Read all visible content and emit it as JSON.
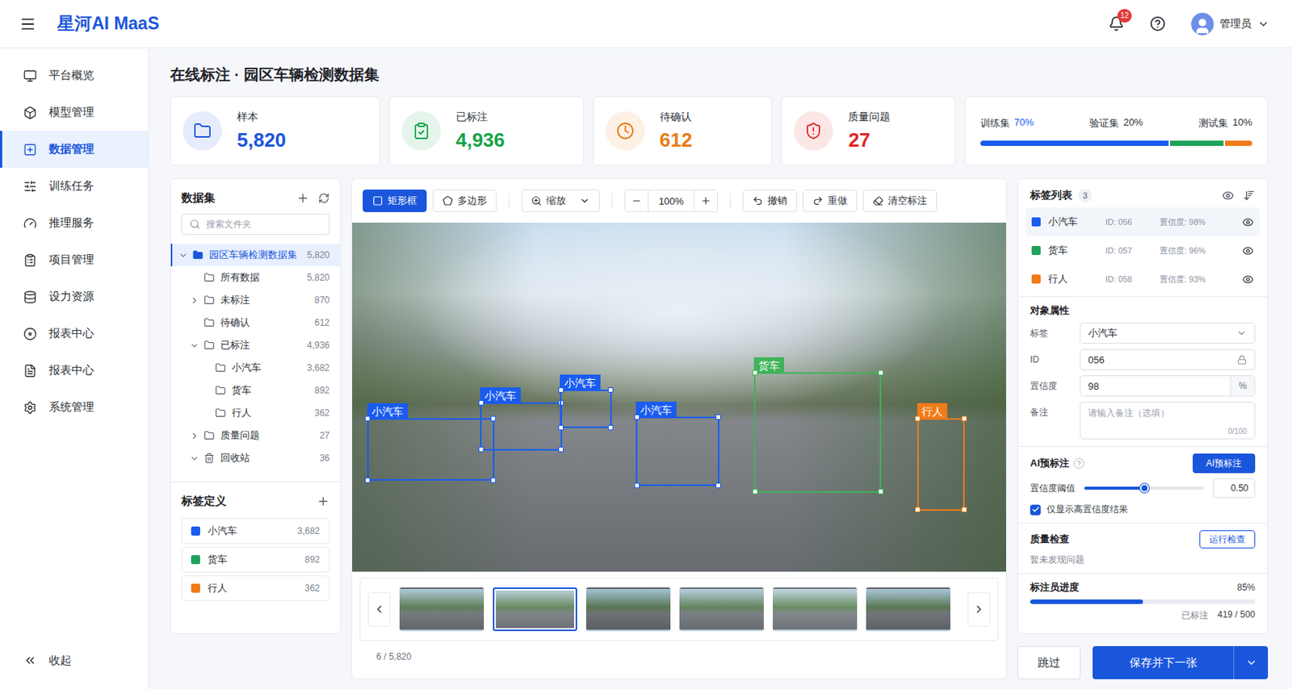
{
  "topbar": {
    "logo": "星河AI MaaS",
    "notifications": "12",
    "user": "管理员"
  },
  "sidebar": {
    "items": [
      {
        "label": "平台概览",
        "selected": false
      },
      {
        "label": "模型管理",
        "selected": false
      },
      {
        "label": "数据管理",
        "selected": true
      },
      {
        "label": "训练任务",
        "selected": false
      },
      {
        "label": "推理服务",
        "selected": false
      },
      {
        "label": "项目管理",
        "selected": false
      },
      {
        "label": "设力资源",
        "selected": false
      },
      {
        "label": "报表中心",
        "selected": false
      },
      {
        "label": "报表中心",
        "selected": false
      },
      {
        "label": "系统管理",
        "selected": false
      }
    ],
    "collapse": "收起"
  },
  "page": {
    "title": "在线标注 · 园区车辆检测数据集"
  },
  "stats": [
    {
      "label": "样本",
      "value": "5,820",
      "kind": "samples",
      "color": "#1a56db"
    },
    {
      "label": "已标注",
      "value": "4,936",
      "kind": "labeled",
      "color": "#16a34a"
    },
    {
      "label": "待确认",
      "value": "612",
      "kind": "pending",
      "color": "#ea7a12"
    },
    {
      "label": "质量问题",
      "value": "27",
      "kind": "issues",
      "color": "#e02424"
    }
  ],
  "split": [
    {
      "label": "训练集",
      "value": "70%",
      "level": 0.7,
      "color": "#1a5cf0"
    },
    {
      "label": "验证集",
      "value": "20%",
      "level": 0.2,
      "color": "#1fa35c"
    },
    {
      "label": "测试集",
      "value": "10%",
      "level": 0.1,
      "color": "#f07b1a"
    }
  ],
  "datasets": {
    "title": "数据集",
    "search_placeholder": "搜索文件夹",
    "tree": [
      {
        "label": "园区车辆检测数据集",
        "count": "5,820",
        "depth": 0,
        "expandable": true,
        "expanded": true,
        "selected": true,
        "kind": "folder"
      },
      {
        "label": "所有数据",
        "count": "5,820",
        "depth": 1,
        "expandable": false,
        "expanded": false,
        "selected": false,
        "kind": "folder"
      },
      {
        "label": "未标注",
        "count": "870",
        "depth": 1,
        "expandable": true,
        "expanded": false,
        "selected": false,
        "kind": "folder"
      },
      {
        "label": "待确认",
        "count": "612",
        "depth": 1,
        "expandable": false,
        "expanded": false,
        "selected": false,
        "kind": "folder"
      },
      {
        "label": "已标注",
        "count": "4,936",
        "depth": 1,
        "expandable": true,
        "expanded": true,
        "selected": false,
        "kind": "folder"
      },
      {
        "label": "小汽车",
        "count": "3,682",
        "depth": 2,
        "expandable": false,
        "expanded": false,
        "selected": false,
        "kind": "folder"
      },
      {
        "label": "货车",
        "count": "892",
        "depth": 2,
        "expandable": false,
        "expanded": false,
        "selected": false,
        "kind": "folder"
      },
      {
        "label": "行人",
        "count": "362",
        "depth": 2,
        "expandable": false,
        "expanded": false,
        "selected": false,
        "kind": "folder"
      },
      {
        "label": "质量问题",
        "count": "27",
        "depth": 1,
        "expandable": true,
        "expanded": false,
        "selected": false,
        "kind": "folder"
      },
      {
        "label": "回收站",
        "count": "36",
        "depth": 1,
        "expandable": true,
        "expanded": true,
        "selected": false,
        "kind": "trash"
      }
    ]
  },
  "label_definitions": {
    "title": "标签定义",
    "items": [
      {
        "name": "小汽车",
        "count": "3,682",
        "color": "#1a5cf0"
      },
      {
        "name": "货车",
        "count": "892",
        "color": "#1fa35c"
      },
      {
        "name": "行人",
        "count": "362",
        "color": "#f07b1a"
      }
    ]
  },
  "toolbar": {
    "tools": [
      {
        "label": "矩形框",
        "selected": true,
        "kind": "rect"
      },
      {
        "label": "多边形",
        "selected": false,
        "kind": "polygon"
      }
    ],
    "zoom": {
      "label": "缩放",
      "value": "100%"
    },
    "actions": [
      {
        "label": "撤销",
        "kind": "undo"
      },
      {
        "label": "重做",
        "kind": "redo"
      },
      {
        "label": "清空标注",
        "kind": "clear"
      }
    ]
  },
  "canvas": {
    "annotations": [
      {
        "label": "小汽车",
        "color": "#1a5cf0"
      },
      {
        "label": "小汽车",
        "color": "#1a5cf0"
      },
      {
        "label": "小汽车",
        "color": "#1a5cf0"
      },
      {
        "label": "小汽车",
        "color": "#1a5cf0"
      },
      {
        "label": "货车",
        "color": "#3fb45a"
      },
      {
        "label": "行人",
        "color": "#f07b1a"
      }
    ]
  },
  "thumbnails": [
    {
      "selected": false
    },
    {
      "selected": true
    },
    {
      "selected": false
    },
    {
      "selected": false
    },
    {
      "selected": false
    },
    {
      "selected": false
    },
    {
      "selected": false
    }
  ],
  "pager": "6 / 5,820",
  "labels": {
    "title": "标签列表",
    "count": "3",
    "items": [
      {
        "name": "小汽车",
        "id": "ID: 056",
        "confidence": "置信度: 98%",
        "color": "#1a5cf0",
        "selected": true
      },
      {
        "name": "货车",
        "id": "ID: 057",
        "confidence": "置信度: 96%",
        "color": "#1fa35c",
        "selected": false
      },
      {
        "name": "行人",
        "id": "ID: 058",
        "confidence": "置信度: 93%",
        "color": "#f07b1a",
        "selected": false
      }
    ]
  },
  "attributes": {
    "title": "对象属性",
    "fields": [
      {
        "label": "标签",
        "value": "小汽车",
        "kind": "select"
      },
      {
        "label": "ID",
        "value": "056",
        "kind": "locked"
      },
      {
        "label": "置信度",
        "value": "98",
        "suffix": "%",
        "kind": "unit"
      },
      {
        "label": "备注",
        "placeholder": "请输入备注（选填）",
        "counter": "0/100",
        "kind": "textarea"
      }
    ]
  },
  "ai": {
    "title": "AI预标注",
    "help": "?",
    "button": "AI预标注",
    "threshold": {
      "label": "置信度阈值",
      "level": 0.5,
      "reading": "0.50"
    },
    "filter": {
      "label": "仅显示高置信度结果",
      "checked": true
    }
  },
  "quality": {
    "title": "质量检查",
    "button": "运行检查",
    "status": "暂未发现问题"
  },
  "progress": {
    "title": "标注员进度",
    "percent": "85%",
    "level": 0.5,
    "label": "已标注",
    "reading": "419 / 500"
  },
  "footer": {
    "skip": "跳过",
    "save": "保存并下一张"
  }
}
